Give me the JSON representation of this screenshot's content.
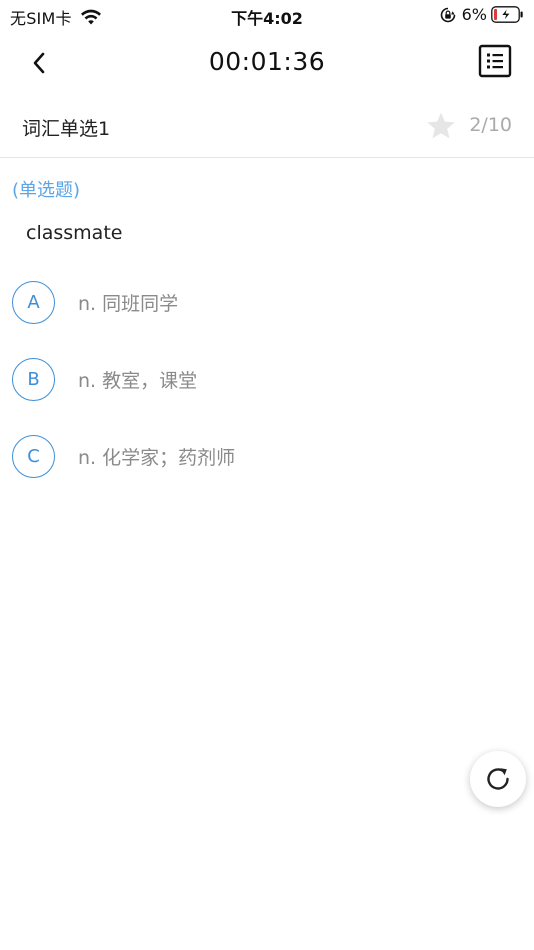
{
  "status_bar": {
    "carrier": "无SIM卡",
    "time": "下午4:02",
    "battery_percent": "6%",
    "icons": [
      "wifi-icon",
      "orientation-lock-icon",
      "battery-charging-icon"
    ]
  },
  "nav": {
    "back_icon": "chevron-left-icon",
    "timer": "00:01:36",
    "sheet_icon": "answer-sheet-list-icon"
  },
  "header": {
    "title": "词汇单选1",
    "favorite_icon": "star-icon",
    "progress": "2/10"
  },
  "question": {
    "type": "(单选题)",
    "word": "classmate",
    "options": [
      {
        "letter": "A",
        "text": "n. 同班同学"
      },
      {
        "letter": "B",
        "text": "n. 教室，课堂"
      },
      {
        "letter": "C",
        "text": "n. 化学家；药剂师"
      }
    ]
  },
  "fab": {
    "icon": "refresh-icon"
  },
  "colors": {
    "accent": "#3d8fd8",
    "question_type": "#5aa5e6",
    "option_text": "#8a8a8a",
    "muted": "#aaaaaa",
    "star": "#e6e6e6",
    "battery_low": "#e0393e"
  }
}
